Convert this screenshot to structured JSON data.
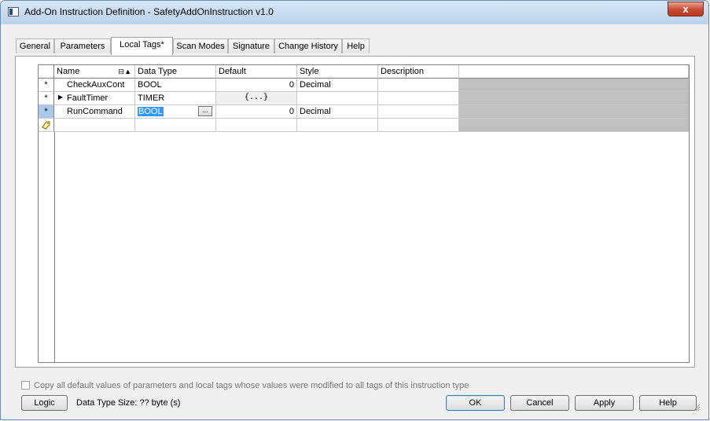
{
  "window": {
    "title": "Add-On Instruction Definition - SafetyAddOnInstruction v1.0",
    "close_label": "x"
  },
  "tabs": [
    {
      "label": "General"
    },
    {
      "label": "Parameters"
    },
    {
      "label": "Local Tags*"
    },
    {
      "label": "Scan Modes"
    },
    {
      "label": "Signature"
    },
    {
      "label": "Change History"
    },
    {
      "label": "Help"
    }
  ],
  "active_tab": "Local Tags*",
  "grid": {
    "columns": [
      "Name",
      "Data Type",
      "Default",
      "Style",
      "Description"
    ],
    "sort_icon": "sort-asc-icon",
    "rows": [
      {
        "indicator": "*",
        "expand": "",
        "name": "CheckAuxCont",
        "data_type": "BOOL",
        "default": "0",
        "style": "Decimal",
        "description": ""
      },
      {
        "indicator": "*",
        "expand": "▶",
        "name": "FaultTimer",
        "data_type": "TIMER",
        "default": "{...}",
        "style": "",
        "description": ""
      },
      {
        "indicator": "*",
        "expand": "",
        "name": "RunCommand",
        "data_type": "BOOL",
        "default": "0",
        "style": "Decimal",
        "description": "",
        "selected": true,
        "browse_label": "..."
      }
    ],
    "new_row_icon": "new-tag-icon"
  },
  "copy_defaults_label": "Copy all default values of parameters and local tags whose values were modified to all tags of this instruction type",
  "copy_defaults_checked": false,
  "buttons": {
    "logic": "Logic",
    "ok": "OK",
    "cancel": "Cancel",
    "apply": "Apply",
    "help": "Help"
  },
  "status_text": "Data Type Size: ?? byte (s)",
  "colors": {
    "selection": "#3399ff",
    "grid_gray": "#c0c0c0",
    "titlebar": "#bcd3ec",
    "close": "#c74a32"
  }
}
